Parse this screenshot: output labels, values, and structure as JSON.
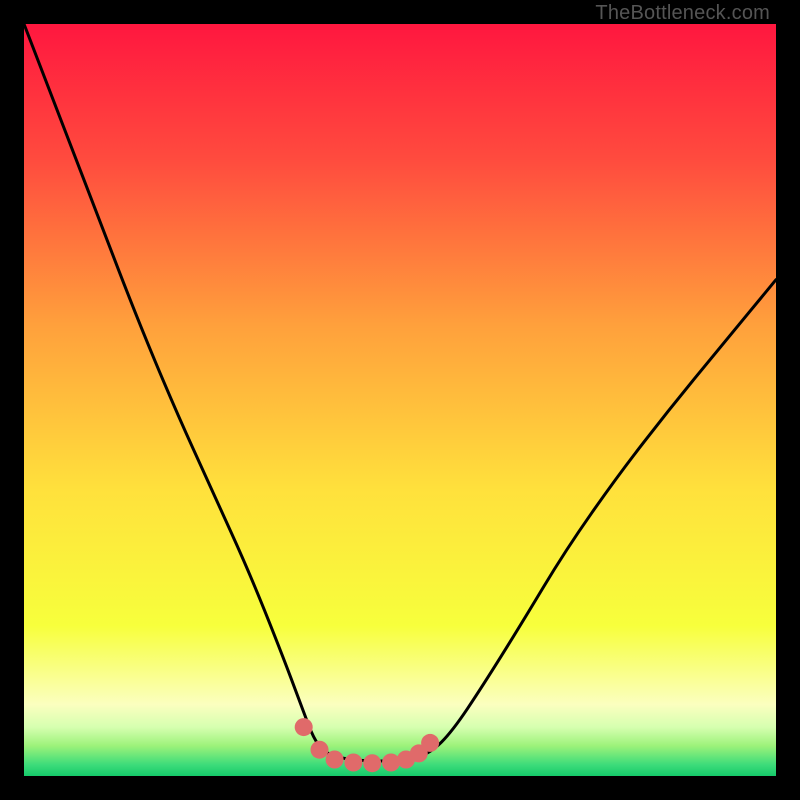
{
  "attribution": "TheBottleneck.com",
  "chart_data": {
    "type": "line",
    "title": "",
    "xlabel": "",
    "ylabel": "",
    "xlim": [
      0,
      1
    ],
    "ylim": [
      0,
      1
    ],
    "gradient_stops": [
      {
        "offset": 0.0,
        "color": "#ff173f"
      },
      {
        "offset": 0.18,
        "color": "#ff4b3e"
      },
      {
        "offset": 0.4,
        "color": "#ffa03c"
      },
      {
        "offset": 0.62,
        "color": "#ffe13c"
      },
      {
        "offset": 0.8,
        "color": "#f7ff3c"
      },
      {
        "offset": 0.905,
        "color": "#fbffbf"
      },
      {
        "offset": 0.935,
        "color": "#d6ffb0"
      },
      {
        "offset": 0.96,
        "color": "#9cf27a"
      },
      {
        "offset": 0.985,
        "color": "#3ddc7a"
      },
      {
        "offset": 1.0,
        "color": "#15c96a"
      }
    ],
    "series": [
      {
        "name": "bottleneck-curve",
        "x": [
          0.0,
          0.05,
          0.1,
          0.15,
          0.2,
          0.25,
          0.3,
          0.34,
          0.37,
          0.385,
          0.4,
          0.43,
          0.46,
          0.49,
          0.51,
          0.54,
          0.57,
          0.61,
          0.66,
          0.72,
          0.79,
          0.86,
          0.93,
          1.0
        ],
        "y": [
          1.0,
          0.87,
          0.74,
          0.61,
          0.49,
          0.38,
          0.27,
          0.17,
          0.09,
          0.05,
          0.03,
          0.022,
          0.02,
          0.02,
          0.022,
          0.03,
          0.06,
          0.12,
          0.2,
          0.3,
          0.4,
          0.49,
          0.575,
          0.66
        ]
      }
    ],
    "markers": {
      "name": "valley-markers",
      "color": "#e06a6a",
      "radius_frac": 0.012,
      "points": [
        {
          "x": 0.372,
          "y": 0.065
        },
        {
          "x": 0.393,
          "y": 0.035
        },
        {
          "x": 0.413,
          "y": 0.022
        },
        {
          "x": 0.438,
          "y": 0.018
        },
        {
          "x": 0.463,
          "y": 0.017
        },
        {
          "x": 0.488,
          "y": 0.018
        },
        {
          "x": 0.508,
          "y": 0.022
        },
        {
          "x": 0.525,
          "y": 0.03
        },
        {
          "x": 0.54,
          "y": 0.044
        }
      ]
    }
  }
}
